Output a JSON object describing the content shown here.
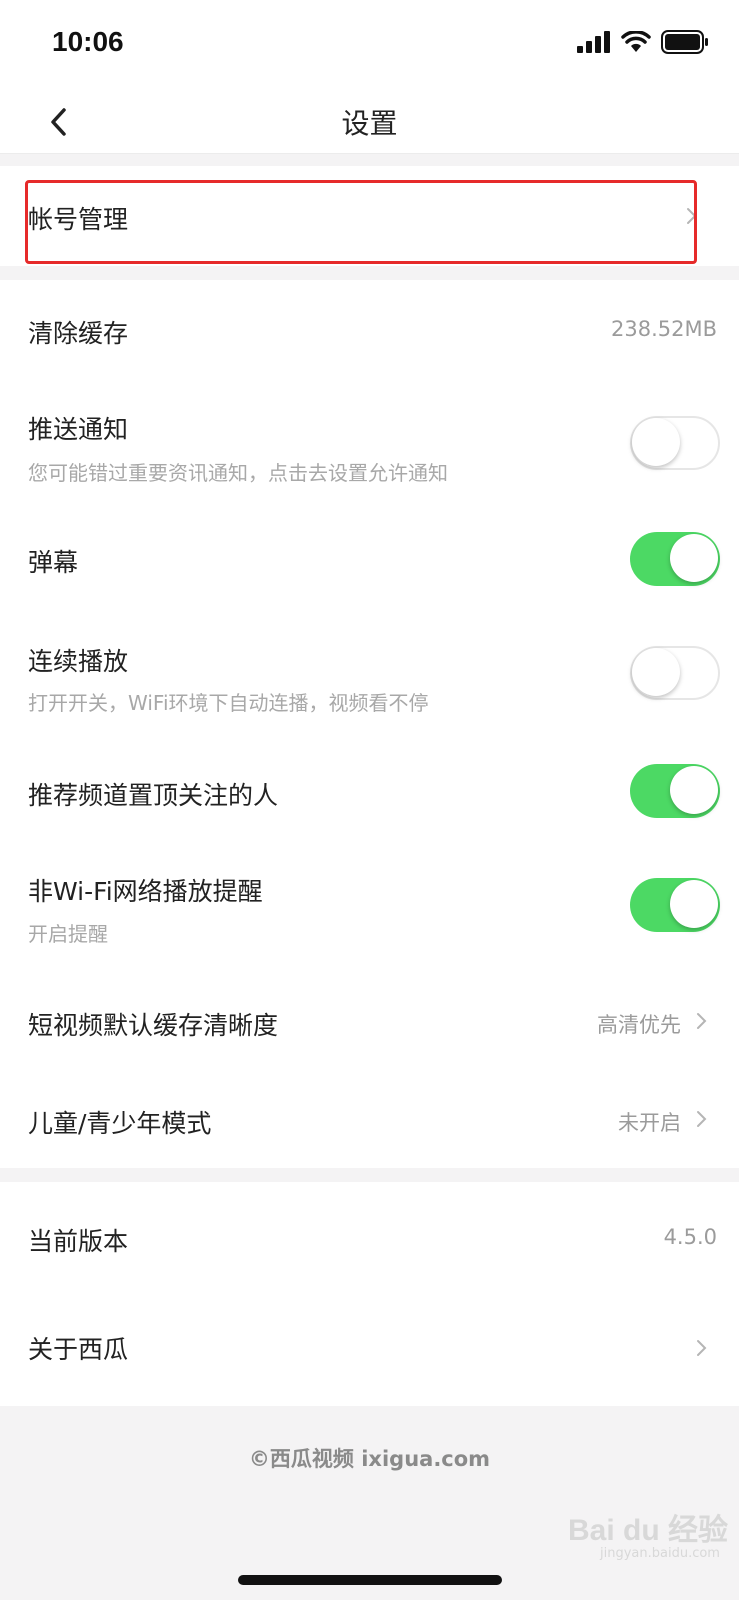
{
  "status_bar": {
    "time": "10:06"
  },
  "nav": {
    "title": "设置"
  },
  "account": {
    "label": "帐号管理"
  },
  "settings": {
    "clear_cache": {
      "label": "清除缓存",
      "value": "238.52MB"
    },
    "push_notify": {
      "label": "推送通知",
      "sub": "您可能错过重要资讯通知，点击去设置允许通知",
      "on": false
    },
    "danmaku": {
      "label": "弹幕",
      "on": true
    },
    "autoplay": {
      "label": "连续播放",
      "sub": "打开开关，WiFi环境下自动连播，视频看不停",
      "on": false
    },
    "pin_follow": {
      "label": "推荐频道置顶关注的人",
      "on": true
    },
    "non_wifi": {
      "label": "非Wi-Fi网络播放提醒",
      "sub": "开启提醒",
      "on": true
    },
    "cache_quality": {
      "label": "短视频默认缓存清晰度",
      "value": "高清优先"
    },
    "kids_mode": {
      "label": "儿童/青少年模式",
      "value": "未开启"
    }
  },
  "about": {
    "version": {
      "label": "当前版本",
      "value": "4.5.0"
    },
    "about_xigua": {
      "label": "关于西瓜"
    }
  },
  "footer": {
    "text": "©西瓜视频 ixigua.com"
  },
  "watermark": {
    "text": "Bai du 经验",
    "sub": "jingyan.baidu.com"
  },
  "colors": {
    "toggle_on": "#4cd964",
    "highlight": "#e62a2a"
  }
}
